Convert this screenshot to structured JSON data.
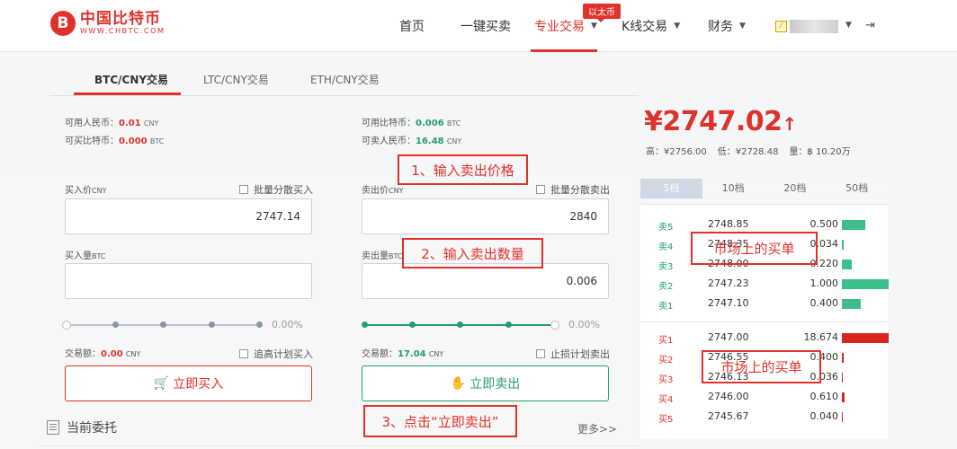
{
  "header": {
    "logo_mark": "B",
    "logo_name": "中国比特币",
    "logo_url": "WWW.CHBTC.COM",
    "nav": {
      "home": "首页",
      "quick": "一键买卖",
      "pro": "专业交易",
      "kline": "K线交易",
      "finance": "财务"
    },
    "badge": "以太币"
  },
  "tabs": [
    "BTC/CNY交易",
    "LTC/CNY交易",
    "ETH/CNY交易"
  ],
  "balances": {
    "cny_label": "可用人民币：",
    "cny_value": "0.01",
    "cny_unit": "CNY",
    "buyable_label": "可买比特币：",
    "buyable_value": "0.000",
    "buyable_unit": "BTC",
    "btc_label": "可用比特币：",
    "btc_value": "0.006",
    "btc_unit": "BTC",
    "sellable_label": "可卖人民币：",
    "sellable_value": "16.48",
    "sellable_unit": "CNY"
  },
  "ticker": {
    "price": "¥2747.02",
    "arrow": "↑",
    "high": "高：¥2756.00",
    "low": "低：¥2728.48",
    "volume": "量：฿ 10.20万"
  },
  "buy_form": {
    "price_label": "买入价",
    "price_unit": "CNY",
    "batch_label": "批量分散买入",
    "price_value": "2747.14",
    "qty_label": "买入量",
    "qty_unit": "BTC",
    "qty_value": "",
    "pct": "0.00%",
    "amount_label": "交易额：",
    "amount_value": "0.00",
    "amount_unit": "CNY",
    "plan_label": "追高计划买入",
    "button": "立即买入"
  },
  "sell_form": {
    "price_label": "卖出价",
    "price_unit": "CNY",
    "batch_label": "批量分散卖出",
    "price_value": "2840",
    "qty_label": "卖出量",
    "qty_unit": "BTC",
    "qty_value": "0.006",
    "pct": "0.00%",
    "amount_label": "交易额：",
    "amount_value": "17.04",
    "amount_unit": "CNY",
    "plan_label": "止损计划卖出",
    "button": "立即卖出"
  },
  "orders": {
    "title": "当前委托",
    "more": "更多>>"
  },
  "orderbook": {
    "tabs": [
      "5档",
      "10档",
      "20档",
      "50档"
    ],
    "asks": [
      {
        "label": "卖5",
        "price": "2748.85",
        "qty": "0.500",
        "depth": 0.5
      },
      {
        "label": "卖4",
        "price": "2748.35",
        "qty": "0.034",
        "depth": 0.034
      },
      {
        "label": "卖3",
        "price": "2748.00",
        "qty": "0.220",
        "depth": 0.22
      },
      {
        "label": "卖2",
        "price": "2747.23",
        "qty": "1.000",
        "depth": 1.0
      },
      {
        "label": "卖1",
        "price": "2747.10",
        "qty": "0.400",
        "depth": 0.4
      }
    ],
    "bids": [
      {
        "label": "买1",
        "price": "2747.00",
        "qty": "18.674",
        "depth": 1.0
      },
      {
        "label": "买2",
        "price": "2746.55",
        "qty": "0.400",
        "depth": 0.04
      },
      {
        "label": "买3",
        "price": "2746.13",
        "qty": "0.036",
        "depth": 0.004
      },
      {
        "label": "买4",
        "price": "2746.00",
        "qty": "0.610",
        "depth": 0.06
      },
      {
        "label": "买5",
        "price": "2745.67",
        "qty": "0.040",
        "depth": 0.004
      }
    ]
  },
  "annotations": {
    "step1": "1、输入卖出价格",
    "step2": "2、输入卖出数量",
    "step3": "3、点击“立即卖出”",
    "market_buy_1": "市场上的买单",
    "market_buy_2": "市场上的买单"
  },
  "colors": {
    "accent": "#e0312b",
    "green": "#22a06b"
  }
}
